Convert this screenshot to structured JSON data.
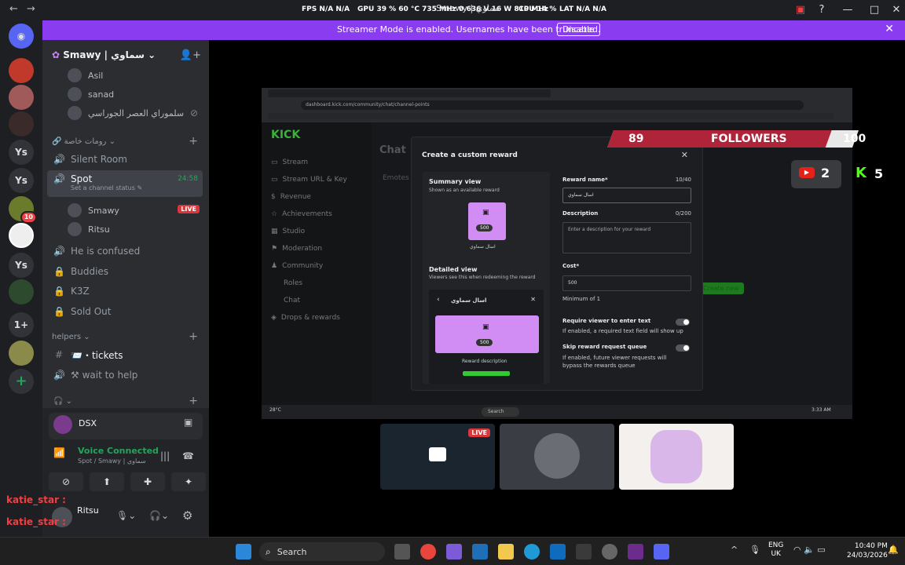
{
  "titlebar": {
    "window_title": "Smawy | سماوي",
    "fps_label": "FPS",
    "fps": "N/A",
    "fps2": "N/A",
    "gpu_label": "GPU",
    "gpu": "39 % 60 °C 735 MHz 0.636 V 16 W 810 MHz",
    "cpu_label": "CPU",
    "cpu": "14 %",
    "lat_label": "LAT",
    "lat": "N/A",
    "lat2": "N/A"
  },
  "banner": {
    "message": "Streamer Mode is enabled. Usernames have been truncated.",
    "button": "Disable"
  },
  "rail": {
    "items": [
      "Ys",
      "Ys",
      "Ys",
      "1+"
    ],
    "badge": "10"
  },
  "server": {
    "name": "Smawy | سماوي"
  },
  "voice_users_top": [
    "Asil",
    "sanad",
    "سلموراي العصر الجوراسي"
  ],
  "categories": {
    "private": "رومات خاصة",
    "helpers": "helpers"
  },
  "channels": {
    "silent": "Silent Room",
    "spot": "Spot",
    "spot_status": "Set a channel status",
    "spot_time": "24:58",
    "spot_users": [
      "Smawy",
      "Ritsu"
    ],
    "live": "LIVE",
    "confused": "He is confused",
    "buddies": "Buddies",
    "k3z": "K3Z",
    "soldout": "Sold Out",
    "tickets": "📨・tickets",
    "wait": "⚒ wait to help"
  },
  "panel": {
    "user": "DSX",
    "voice_status": "Voice Connected",
    "voice_channel": "Spot / Smawy | سماوي",
    "bottom_user": "Ritsu",
    "overlay1": "katie_star :",
    "overlay2": "katie_star :"
  },
  "stream": {
    "url": "dashboard.kick.com/community/chat/channel-points",
    "kick_logo": "KICK",
    "chat_heading": "Chat",
    "emotes": "Emotes",
    "nav": [
      "Stream",
      "Stream URL & Key",
      "Revenue",
      "Achievements",
      "Studio",
      "Moderation",
      "Community",
      "Roles",
      "Chat",
      "Drops & rewards"
    ],
    "create_new": "Create new",
    "modal": {
      "title": "Create a custom reward",
      "summary": "Summary view",
      "summary_sub": "Shown as an available reward",
      "cost_val": "500",
      "reward_label": "اسال سماوي",
      "detailed": "Detailed view",
      "detailed_sub": "Viewers see this when redeeming the reward",
      "detail_title": "اسال سماوي",
      "reward_desc": "Reward description",
      "name_label": "Reward name*",
      "name_count": "10/40",
      "name_value": "اسال سماوي",
      "desc_label": "Description",
      "desc_count": "0/200",
      "desc_placeholder": "Enter a description for your reward",
      "cost_label": "Cost*",
      "cost_value": "500",
      "min": "Minimum of 1",
      "req_label": "Require viewer to enter text",
      "req_sub": "If enabled, a required text field will show up",
      "skip_label": "Skip reward request queue",
      "skip_sub": "If enabled, future viewer requests will bypass the rewards queue"
    },
    "followers": {
      "current": "89",
      "label": "FOLLOWERS",
      "goal": "100",
      "progress": 0.89
    },
    "yt_count": "2",
    "kick_count": "5",
    "win_search": "Search",
    "weather": "28°C",
    "clock2": "3:33 AM"
  },
  "tiles": {
    "live": "LIVE"
  },
  "taskbar": {
    "search": "Search",
    "lang1": "ENG",
    "lang2": "UK",
    "time": "10:40 PM",
    "date": "24/03/2026"
  }
}
